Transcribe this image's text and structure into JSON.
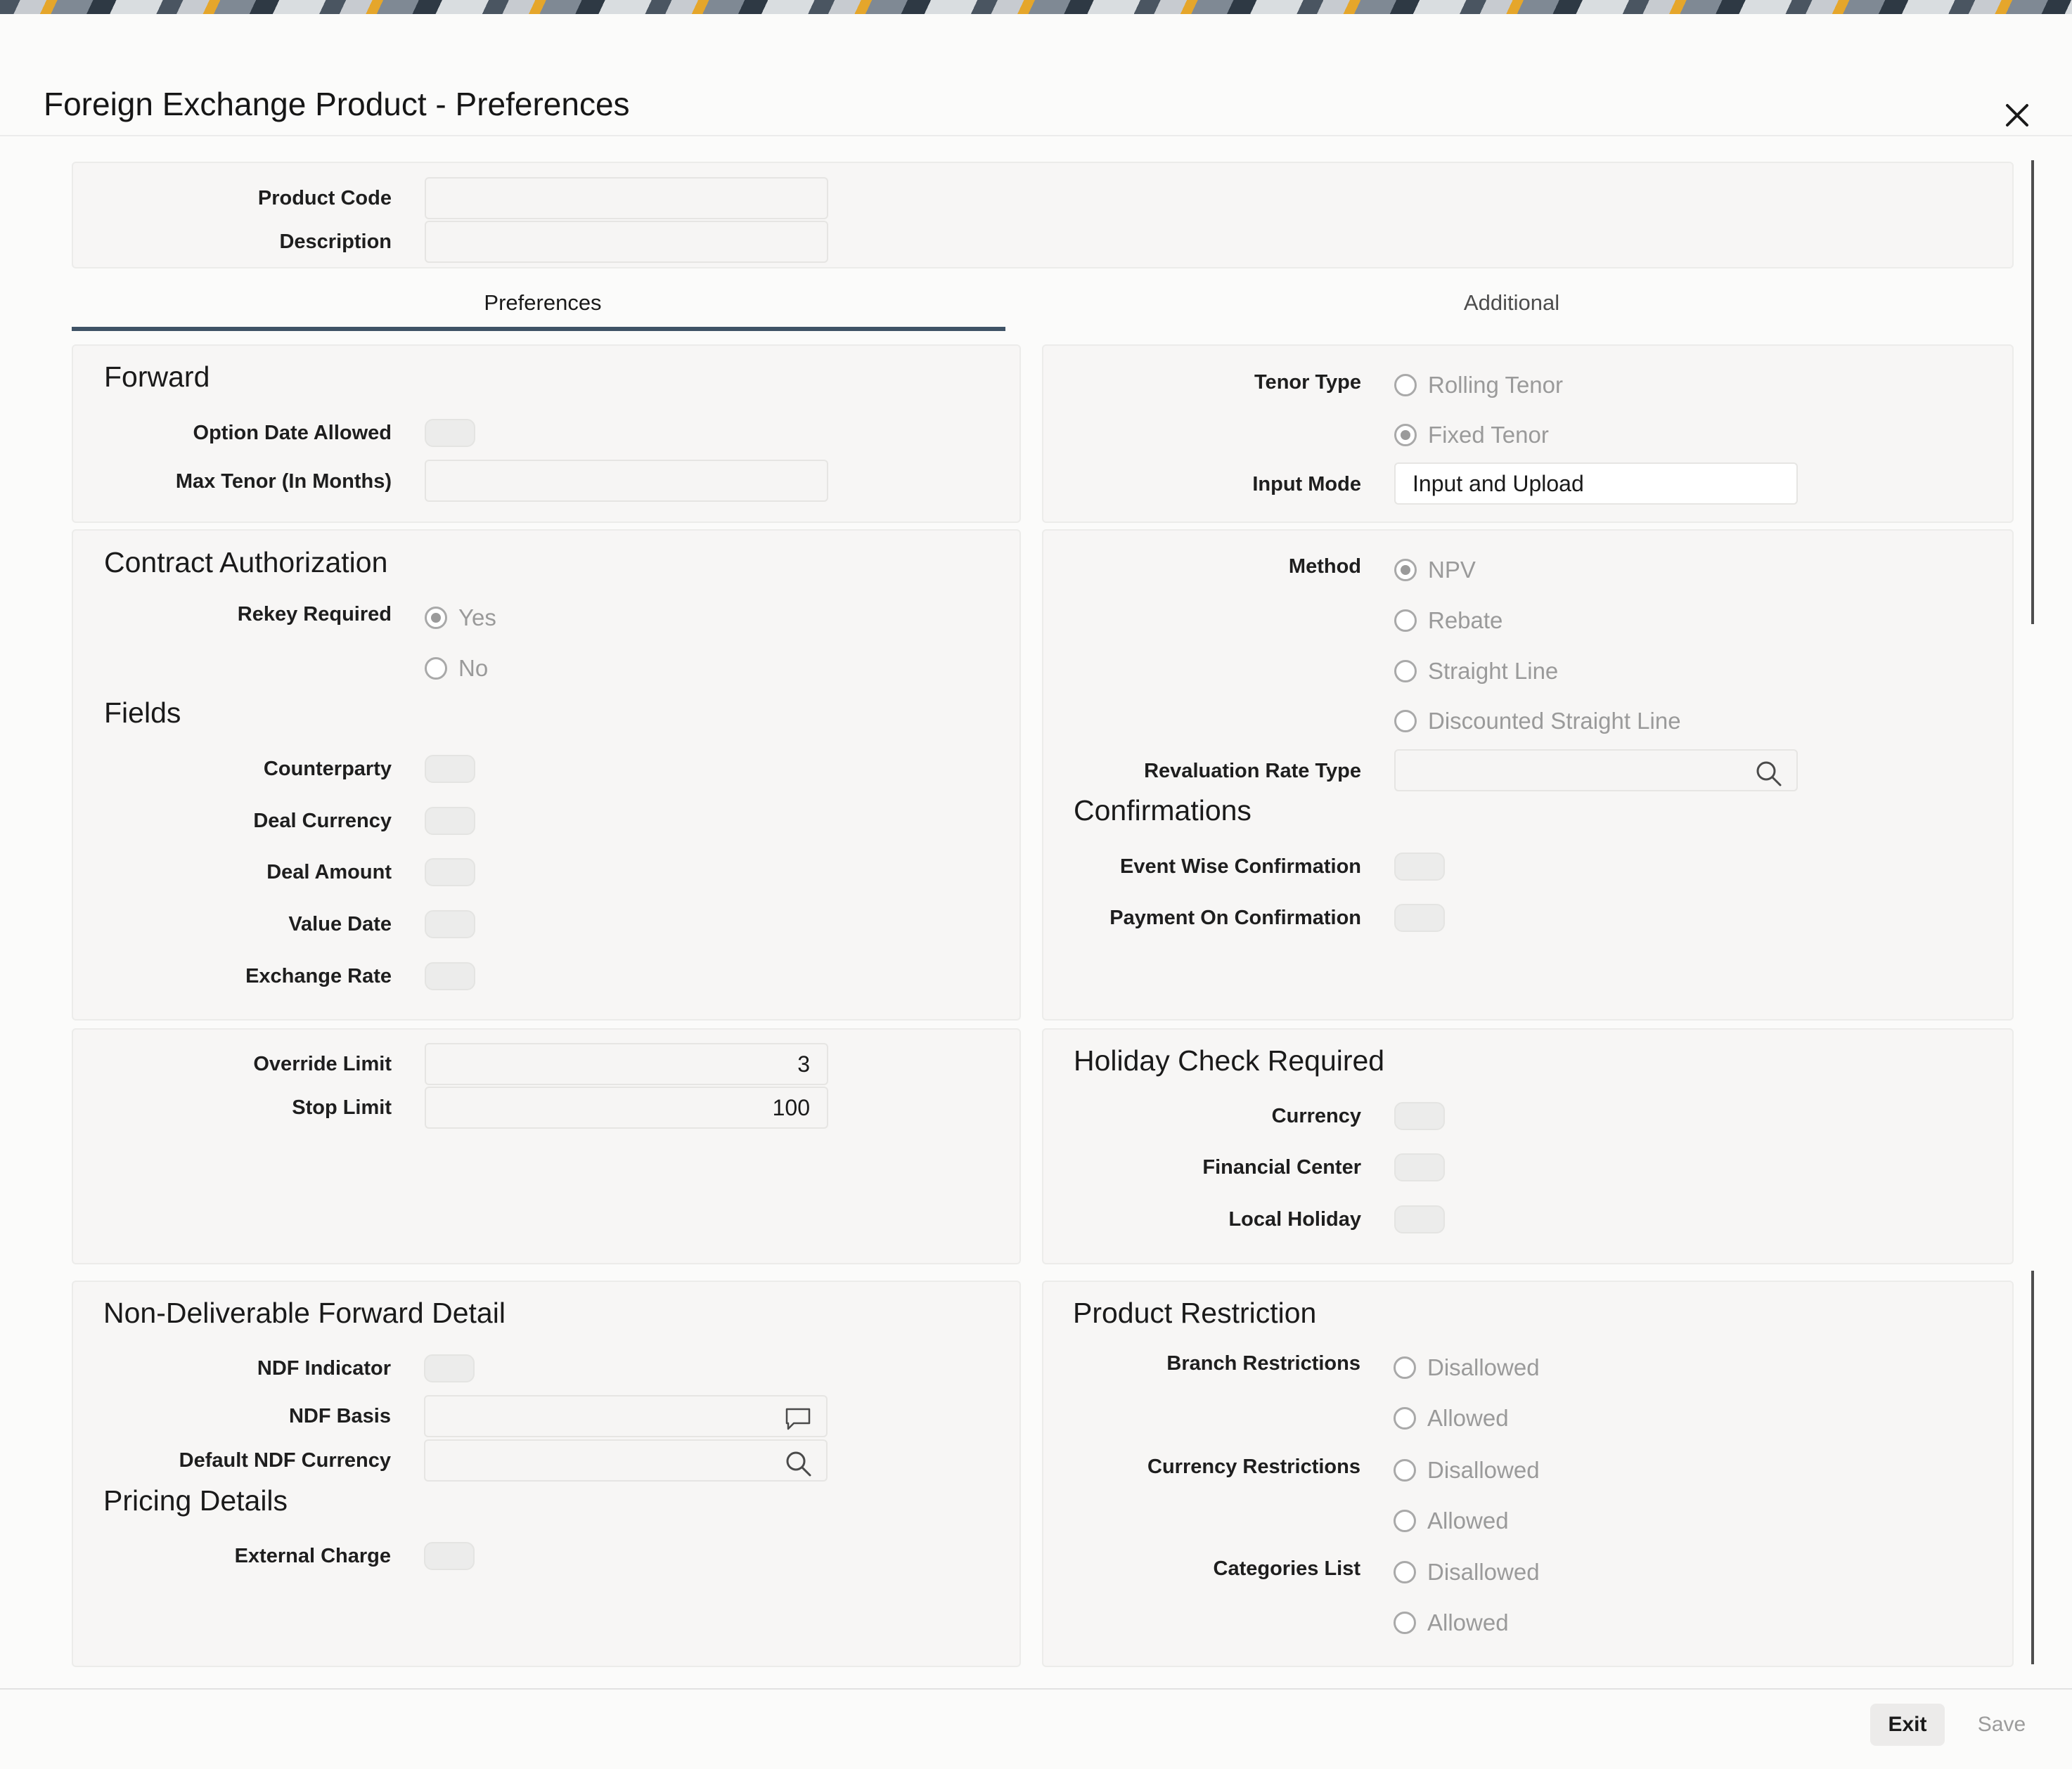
{
  "window": {
    "title": "Foreign Exchange Product - Preferences"
  },
  "header": {
    "product_code_label": "Product Code",
    "product_code_value": "",
    "description_label": "Description",
    "description_value": ""
  },
  "tabs": [
    {
      "label": "Preferences",
      "active": true
    },
    {
      "label": "Additional",
      "active": false
    }
  ],
  "forward": {
    "title": "Forward",
    "option_date_allowed_label": "Option Date Allowed",
    "max_tenor_label": "Max Tenor (In Months)",
    "max_tenor_value": ""
  },
  "tenor": {
    "tenor_type_label": "Tenor Type",
    "rolling_tenor": "Rolling Tenor",
    "fixed_tenor": "Fixed Tenor",
    "selected": "Fixed Tenor",
    "input_mode_label": "Input Mode",
    "input_mode_value": "Input and Upload"
  },
  "contract_authorization": {
    "title": "Contract Authorization",
    "rekey_required_label": "Rekey Required",
    "yes": "Yes",
    "no": "No",
    "selected": "Yes"
  },
  "fields": {
    "title": "Fields",
    "counterparty": "Counterparty",
    "deal_currency": "Deal Currency",
    "deal_amount": "Deal Amount",
    "value_date": "Value Date",
    "exchange_rate": "Exchange Rate"
  },
  "method": {
    "label": "Method",
    "npv": "NPV",
    "rebate": "Rebate",
    "straight_line": "Straight Line",
    "discounted_straight_line": "Discounted Straight Line",
    "selected": "NPV",
    "revaluation_rate_type_label": "Revaluation Rate Type",
    "revaluation_rate_type_value": ""
  },
  "confirmations": {
    "title": "Confirmations",
    "event_wise_label": "Event Wise Confirmation",
    "payment_on_label": "Payment On Confirmation"
  },
  "limits": {
    "override_limit_label": "Override Limit",
    "override_limit_value": "3",
    "stop_limit_label": "Stop Limit",
    "stop_limit_value": "100"
  },
  "holiday": {
    "title": "Holiday Check Required",
    "currency": "Currency",
    "financial_center": "Financial Center",
    "local_holiday": "Local Holiday"
  },
  "ndf": {
    "title": "Non-Deliverable Forward Detail",
    "indicator_label": "NDF Indicator",
    "basis_label": "NDF Basis",
    "basis_value": "",
    "default_currency_label": "Default NDF Currency",
    "default_currency_value": ""
  },
  "pricing": {
    "title": "Pricing Details",
    "external_charge_label": "External Charge"
  },
  "restriction": {
    "title": "Product Restriction",
    "branch_label": "Branch Restrictions",
    "currency_label": "Currency Restrictions",
    "categories_label": "Categories List",
    "disallowed": "Disallowed",
    "allowed": "Allowed"
  },
  "footer": {
    "exit_label": "Exit",
    "save_label": "Save"
  },
  "colors": {
    "tab_underline": "#3f5366",
    "panel_bg": "#f7f6f5",
    "muted_text": "#9a9a9a"
  }
}
